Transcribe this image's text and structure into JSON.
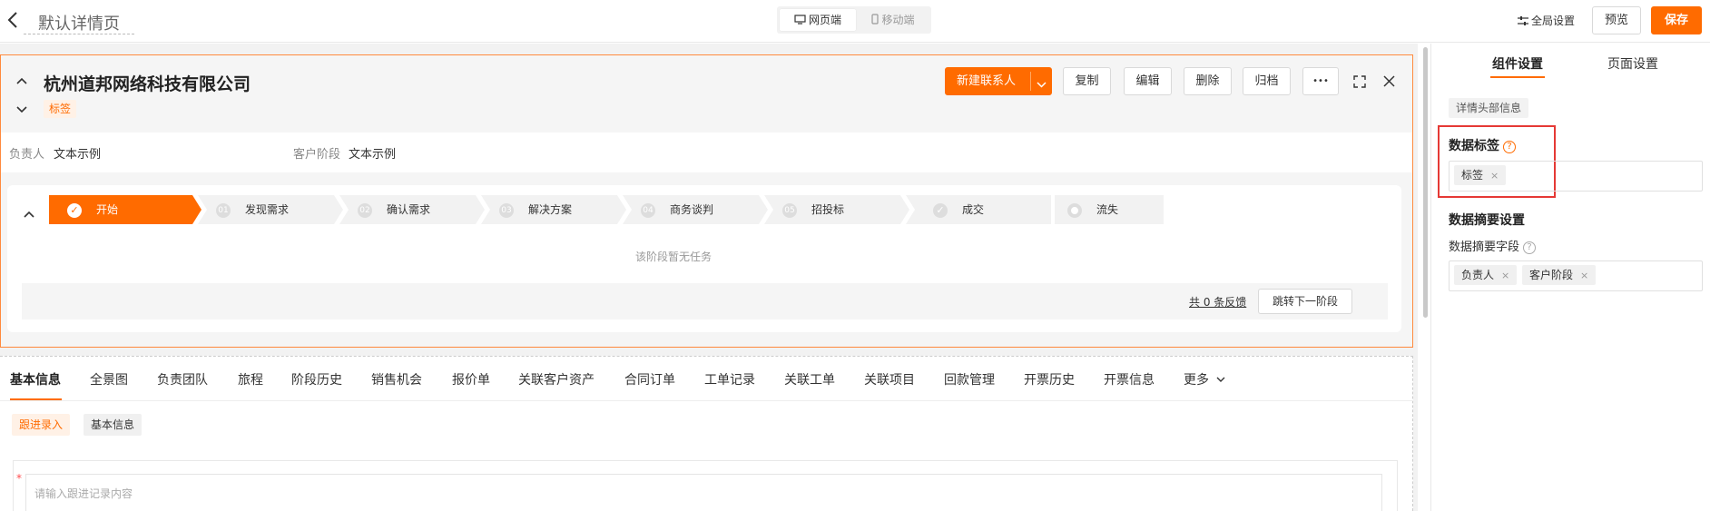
{
  "topbar": {
    "back_icon": "‹",
    "title": "默认详情页",
    "device_web": "网页端",
    "device_mobile": "移动端",
    "global_settings": "全局设置",
    "preview": "预览",
    "save": "保存"
  },
  "header": {
    "company": "杭州道邦网络科技有限公司",
    "tag": "标签",
    "new_contact": "新建联系人",
    "actions": [
      "复制",
      "编辑",
      "删除",
      "归档"
    ],
    "more": "•••",
    "fields": [
      {
        "label": "负责人",
        "value": "文本示例"
      },
      {
        "label": "客户阶段",
        "value": "文本示例"
      }
    ]
  },
  "stages": {
    "items": [
      {
        "num": "✓",
        "label": "开始"
      },
      {
        "num": "01",
        "label": "发现需求"
      },
      {
        "num": "02",
        "label": "确认需求"
      },
      {
        "num": "03",
        "label": "解决方案"
      },
      {
        "num": "04",
        "label": "商务谈判"
      },
      {
        "num": "05",
        "label": "招投标"
      },
      {
        "num": "✓",
        "label": "成交"
      },
      {
        "num": "",
        "label": "流失"
      }
    ],
    "empty": "该阶段暂无任务",
    "feedback": "共 0 条反馈",
    "next": "跳转下一阶段"
  },
  "tabs": {
    "items": [
      "基本信息",
      "全景图",
      "负责团队",
      "旅程",
      "阶段历史",
      "销售机会",
      "报价单",
      "关联客户资产",
      "合同订单",
      "工单记录",
      "关联工单",
      "关联项目",
      "回款管理",
      "开票历史",
      "开票信息"
    ],
    "more": "更多"
  },
  "subtabs": {
    "followup": "跟进录入",
    "basic": "基本信息",
    "required": "*",
    "placeholder": "请输入跟进记录内容"
  },
  "panel": {
    "tab_component": "组件设置",
    "tab_page": "页面设置",
    "section_chip": "详情头部信息",
    "data_tag_title": "数据标签",
    "data_tag_value": "标签",
    "summary_title": "数据摘要设置",
    "summary_field_label": "数据摘要字段",
    "summary_tags": [
      "负责人",
      "客户阶段"
    ],
    "remove": "×",
    "help": "?"
  },
  "colors": {
    "accent": "#ff6b00",
    "highlight_border": "#e53935"
  }
}
